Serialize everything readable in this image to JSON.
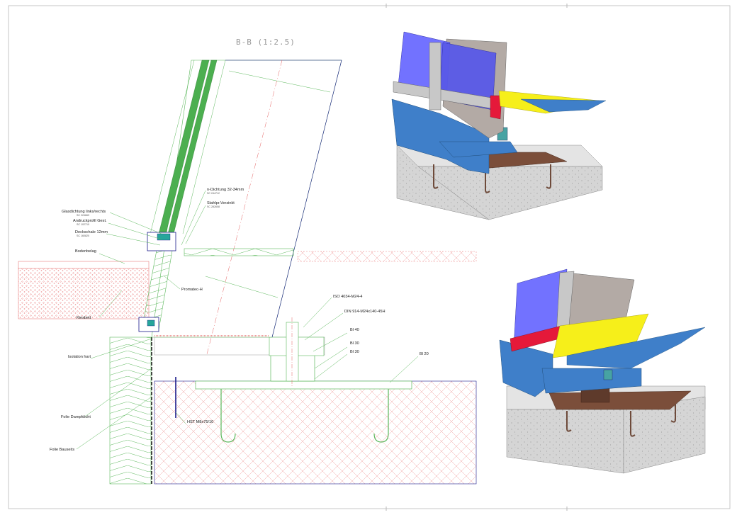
{
  "section_title": "B-B (1:2.5)",
  "colors": {
    "glass": "#4caf50",
    "hatch_red": "#e88080",
    "hatch_green": "#5cb85c",
    "frame_blue": "#6b6bff",
    "profile_blue": "#3f7fc9",
    "gasket_red": "#e5193a",
    "flashing_yellow": "#f6ef1a",
    "bracket_grey": "#a8a8a8",
    "wood_brown": "#7b4e3a",
    "concrete": "#cfcfcf",
    "anchor": "#6e4a3a"
  },
  "labels": {
    "glasdichtung": {
      "text": "Glasdichtung links/rechts",
      "code": "SC 224669"
    },
    "andruckprofil": {
      "text": "Andruckprofil Gest.",
      "code": "SC 102710"
    },
    "deckschale": {
      "text": "Deckschale 12mm",
      "code": "SC 160820"
    },
    "bodenbelag": {
      "text": "Bodenbelag"
    },
    "kiesbett": {
      "text": "Kiesbett"
    },
    "isolation": {
      "text": "Isolation hart"
    },
    "folie_dampf": {
      "text": "Folie Dampfdicht"
    },
    "folie_bau": {
      "text": "Folie Bauseits"
    },
    "dichtung": {
      "text": "n-Dichtung 32-34mm",
      "code": "SC 244712"
    },
    "stahlpr": {
      "text": "Stahlpr.Verzinkt",
      "code": "SC 282608"
    },
    "promatec": {
      "text": "Promatec-H"
    },
    "iso": {
      "text": "ISO 4034-M24-4"
    },
    "din": {
      "text": "DIN 914-M24x140-45H"
    },
    "bl40": {
      "text": "Bl 40"
    },
    "bl30a": {
      "text": "Bl 30"
    },
    "bl30b": {
      "text": "Bl 30"
    },
    "bl20": {
      "text": "Bl 20"
    },
    "hst": {
      "text": "HST M8x75/10"
    }
  }
}
